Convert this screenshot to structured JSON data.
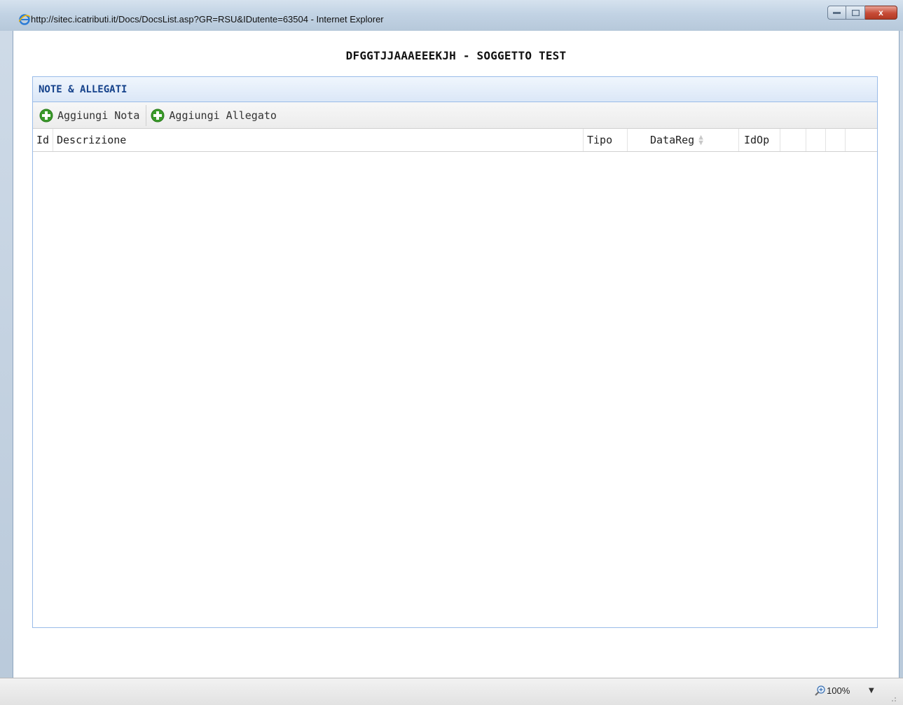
{
  "window": {
    "title": "http://sitec.icatributi.it/Docs/DocsList.asp?GR=RSU&IDutente=63504 - Internet Explorer",
    "minimize_label": "",
    "maximize_label": "",
    "close_label": "x"
  },
  "page": {
    "title": "DFGGTJJAAAEEEKJH - SOGGETTO TEST"
  },
  "panel": {
    "header": "NOTE & ALLEGATI",
    "toolbar": {
      "add_note_label": "Aggiungi Nota",
      "add_attachment_label": "Aggiungi Allegato"
    },
    "grid": {
      "columns": [
        "Id",
        "Descrizione",
        "Tipo",
        "DataReg",
        "IdOp",
        "",
        "",
        "",
        ""
      ],
      "rows": []
    }
  },
  "statusbar": {
    "zoom": "100%"
  },
  "colors": {
    "panel_border": "#99bbe8",
    "panel_header_text": "#15428b",
    "add_icon_green": "#3a9a2a"
  },
  "icons": {
    "browser": "internet-explorer-icon",
    "add": "green-plus-icon",
    "sort": "sort-arrows-icon",
    "zoom": "magnifier-plus-icon"
  }
}
